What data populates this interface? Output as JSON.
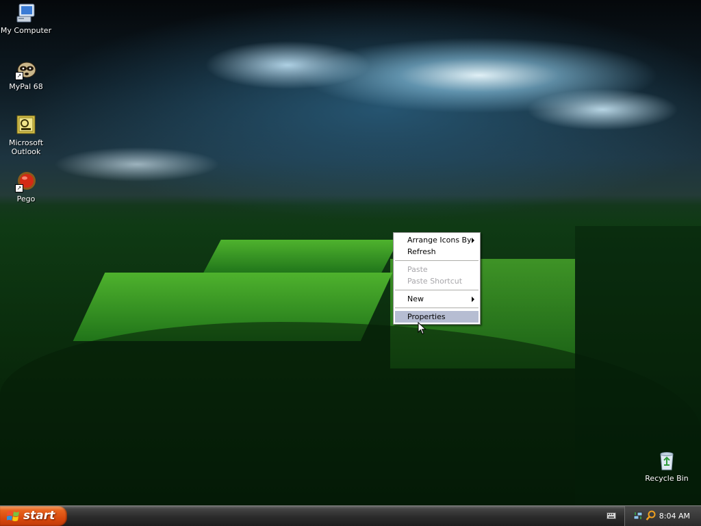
{
  "desktop": {
    "icons": [
      {
        "label": "My Computer",
        "icon": "my-computer-icon"
      },
      {
        "label": "MyPal 68",
        "icon": "mypal-icon"
      },
      {
        "label": "Microsoft Outlook",
        "label_line1": "Microsoft",
        "label_line2": "Outlook",
        "icon": "outlook-icon"
      },
      {
        "label": "Pego",
        "icon": "pego-icon"
      },
      {
        "label": "Recycle Bin",
        "icon": "recycle-bin-icon"
      }
    ]
  },
  "context_menu": {
    "items": [
      {
        "label": "Arrange Icons By",
        "submenu": true,
        "enabled": true
      },
      {
        "label": "Refresh",
        "submenu": false,
        "enabled": true
      },
      {
        "label": "Paste",
        "submenu": false,
        "enabled": false
      },
      {
        "label": "Paste Shortcut",
        "submenu": false,
        "enabled": false
      },
      {
        "label": "New",
        "submenu": true,
        "enabled": true
      },
      {
        "label": "Properties",
        "submenu": false,
        "enabled": true,
        "highlighted": true
      }
    ],
    "highlight_color": "#b6bdd2",
    "disabled_color": "#a7a6aa"
  },
  "taskbar": {
    "start_label": "start",
    "start_color": "#d8490d",
    "clock": "8:04 AM"
  },
  "colors": {
    "sky": "#0d1a22",
    "grass": "#0f3a14",
    "taskbar": "#2c2c2c"
  }
}
